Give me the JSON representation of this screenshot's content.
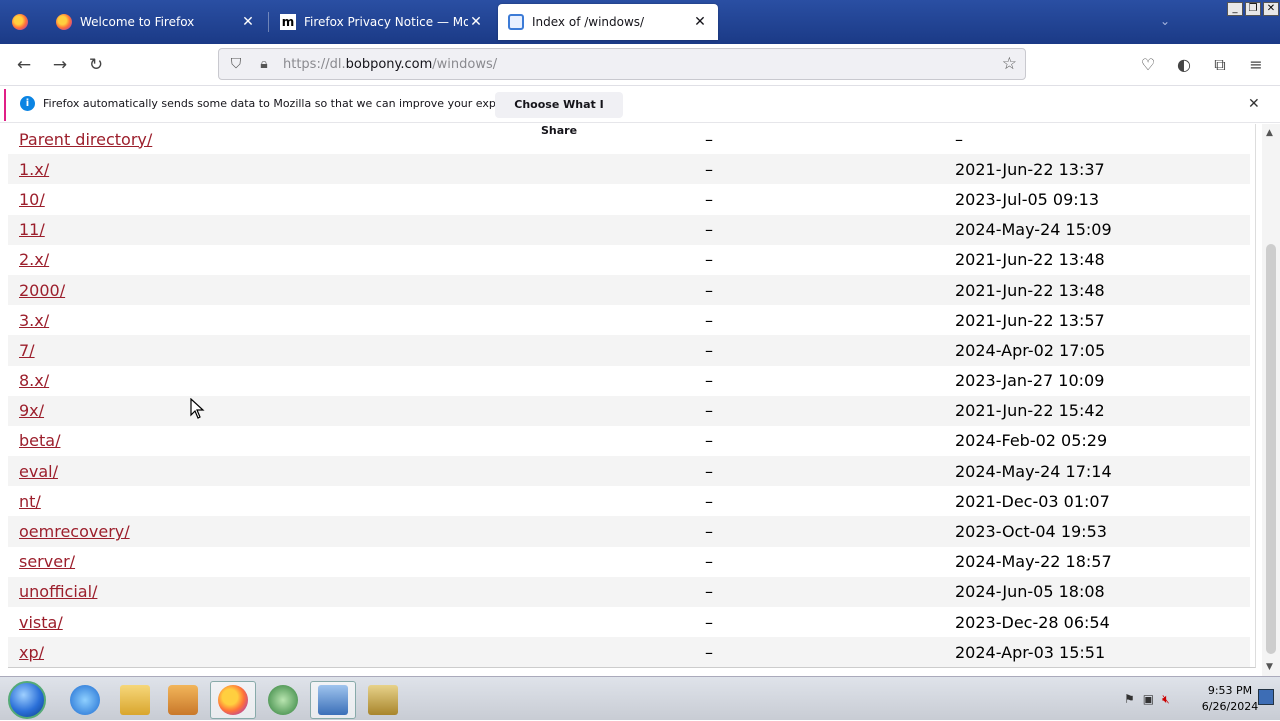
{
  "tabs": [
    {
      "label": "Welcome to Firefox",
      "icon": "firefox-icon"
    },
    {
      "label": "Firefox Privacy Notice — Mozilla",
      "icon": "mozilla-icon"
    },
    {
      "label": "Index of /windows/",
      "icon": "page-icon"
    }
  ],
  "nav": {
    "url_prefix": "https://dl.",
    "url_domain": "bobpony.com",
    "url_path": "/windows/"
  },
  "notice": {
    "message": "Firefox automatically sends some data to Mozilla so that we can improve your experience.",
    "button": "Choose What I Share"
  },
  "listing": [
    {
      "name": "Parent directory/",
      "size": "–",
      "date": "–"
    },
    {
      "name": "1.x/",
      "size": "–",
      "date": "2021-Jun-22 13:37"
    },
    {
      "name": "10/",
      "size": "–",
      "date": "2023-Jul-05 09:13"
    },
    {
      "name": "11/",
      "size": "–",
      "date": "2024-May-24 15:09"
    },
    {
      "name": "2.x/",
      "size": "–",
      "date": "2021-Jun-22 13:48"
    },
    {
      "name": "2000/",
      "size": "–",
      "date": "2021-Jun-22 13:48"
    },
    {
      "name": "3.x/",
      "size": "–",
      "date": "2021-Jun-22 13:57"
    },
    {
      "name": "7/",
      "size": "–",
      "date": "2024-Apr-02 17:05"
    },
    {
      "name": "8.x/",
      "size": "–",
      "date": "2023-Jan-27 10:09"
    },
    {
      "name": "9x/",
      "size": "–",
      "date": "2021-Jun-22 15:42"
    },
    {
      "name": "beta/",
      "size": "–",
      "date": "2024-Feb-02 05:29"
    },
    {
      "name": "eval/",
      "size": "–",
      "date": "2024-May-24 17:14"
    },
    {
      "name": "nt/",
      "size": "–",
      "date": "2021-Dec-03 01:07"
    },
    {
      "name": "oemrecovery/",
      "size": "–",
      "date": "2023-Oct-04 19:53"
    },
    {
      "name": "server/",
      "size": "–",
      "date": "2024-May-22 18:57"
    },
    {
      "name": "unofficial/",
      "size": "–",
      "date": "2024-Jun-05 18:08"
    },
    {
      "name": "vista/",
      "size": "–",
      "date": "2023-Dec-28 06:54"
    },
    {
      "name": "xp/",
      "size": "–",
      "date": "2024-Apr-03 15:51"
    }
  ],
  "taskbar": {
    "clock_time": "9:53 PM",
    "clock_date": "6/26/2024",
    "items": [
      "internet-explorer-icon",
      "file-explorer-icon",
      "media-player-icon",
      "firefox-icon",
      "network-globe-icon",
      "control-panel-icon",
      "archive-icon"
    ]
  },
  "colors": {
    "titlebar": "#1f3f8c",
    "link": "#9c1f2c",
    "notice_accent": "#e01f86",
    "info": "#0b84e3"
  }
}
